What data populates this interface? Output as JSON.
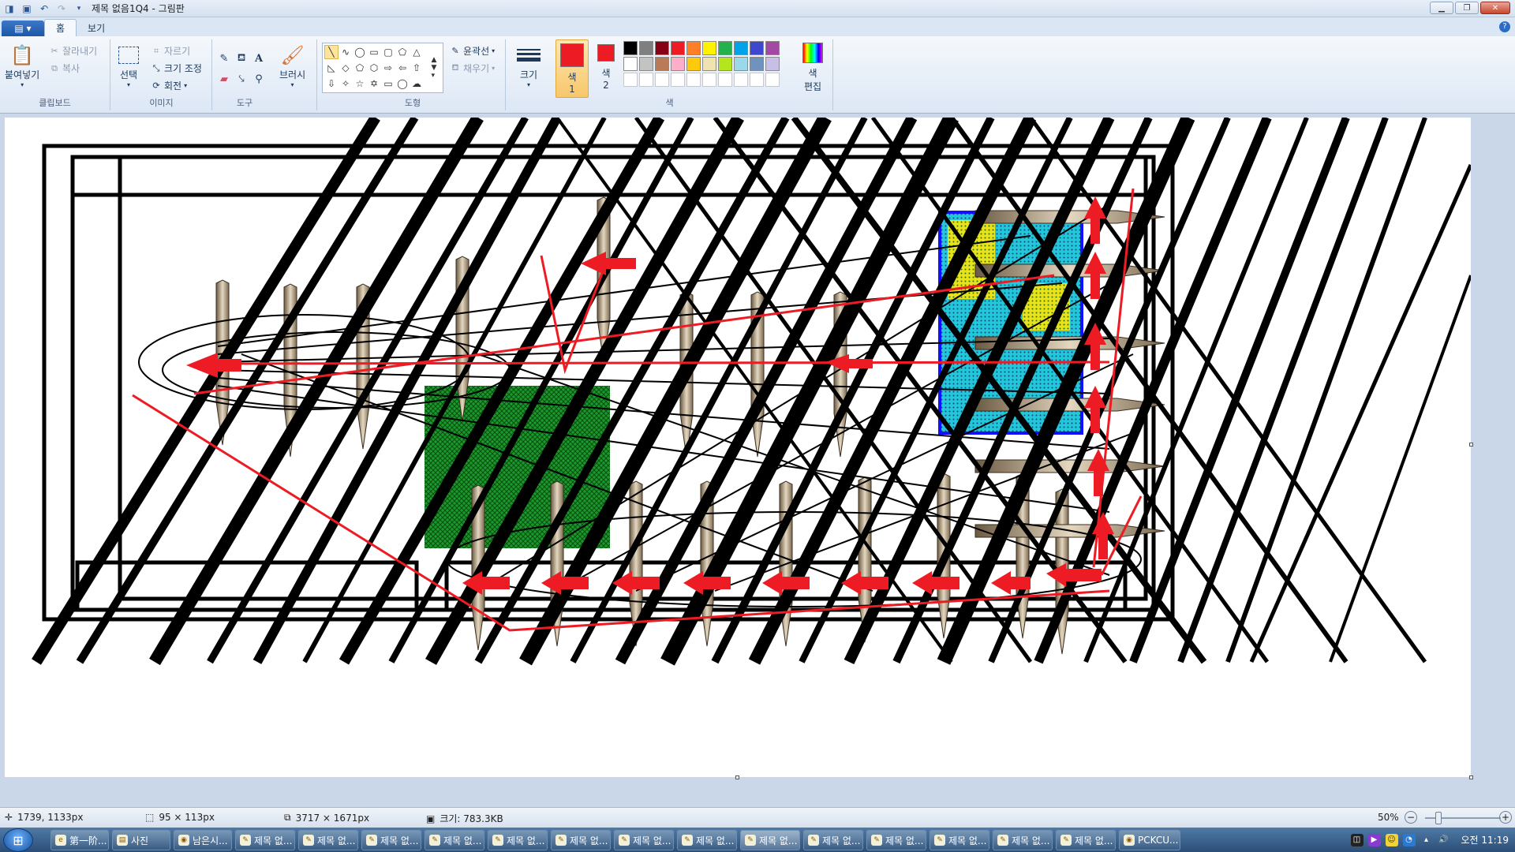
{
  "window": {
    "title": "제목 없음1Q4 - 그림판"
  },
  "tabs": {
    "home": "홈",
    "view": "보기"
  },
  "clipboard": {
    "paste": "붙여넣기",
    "cut": "잘라내기",
    "copy": "복사",
    "group_label": "클립보드"
  },
  "image": {
    "select": "선택",
    "crop": "자르기",
    "resize": "크기 조정",
    "rotate": "회전",
    "group_label": "이미지"
  },
  "tools": {
    "group_label": "도구",
    "brush": "브러시"
  },
  "shapes": {
    "outline": "윤곽선",
    "fill": "채우기",
    "group_label": "도형",
    "size": "크기"
  },
  "colors": {
    "color1": "색 1",
    "color1_line1": "색",
    "color1_line2": "1",
    "color2_line1": "색",
    "color2_line2": "2",
    "edit_line1": "색",
    "edit_line2": "편집",
    "group_label": "색",
    "color1_value": "#ed1c24",
    "color2_value": "#ed1c24",
    "palette": [
      "#000000",
      "#7f7f7f",
      "#880015",
      "#ed1c24",
      "#ff7f27",
      "#fff200",
      "#22b14c",
      "#00a2e8",
      "#3f48cc",
      "#a349a4",
      "#ffffff",
      "#c3c3c3",
      "#b97a57",
      "#ffaec9",
      "#ffc90e",
      "#efe4b0",
      "#b5e61d",
      "#99d9ea",
      "#7092be",
      "#c8bfe7",
      "#ffffff",
      "#ffffff",
      "#ffffff",
      "#ffffff",
      "#ffffff",
      "#ffffff",
      "#ffffff",
      "#ffffff",
      "#ffffff",
      "#ffffff"
    ]
  },
  "status": {
    "cursor_pos": "1739, 1133px",
    "selection_size": "95 × 113px",
    "image_size": "3717 × 1671px",
    "file_size": "크기: 783.3KB",
    "zoom": "50%"
  },
  "taskbar": {
    "items": [
      {
        "label": "第一阶...",
        "icon": "ie-icon"
      },
      {
        "label": "사진",
        "icon": "folder-icon"
      },
      {
        "label": "남은시...",
        "icon": "app-icon"
      },
      {
        "label": "제목 없...",
        "icon": "paint-icon"
      },
      {
        "label": "제목 없...",
        "icon": "paint-icon"
      },
      {
        "label": "제목 없...",
        "icon": "paint-icon"
      },
      {
        "label": "제목 없...",
        "icon": "paint-icon"
      },
      {
        "label": "제목 없...",
        "icon": "paint-icon"
      },
      {
        "label": "제목 없...",
        "icon": "paint-icon"
      },
      {
        "label": "제목 없...",
        "icon": "paint-icon"
      },
      {
        "label": "제목 없...",
        "icon": "paint-icon"
      },
      {
        "label": "제목 없...",
        "icon": "paint-icon"
      },
      {
        "label": "제목 없...",
        "icon": "paint-icon"
      },
      {
        "label": "제목 없...",
        "icon": "paint-icon"
      },
      {
        "label": "제목 없...",
        "icon": "paint-icon"
      },
      {
        "label": "제목 없...",
        "icon": "paint-icon"
      },
      {
        "label": "제목 없...",
        "icon": "paint-icon"
      },
      {
        "label": "PCKCU...",
        "icon": "app-icon"
      }
    ],
    "clock": "오전 11:19"
  }
}
